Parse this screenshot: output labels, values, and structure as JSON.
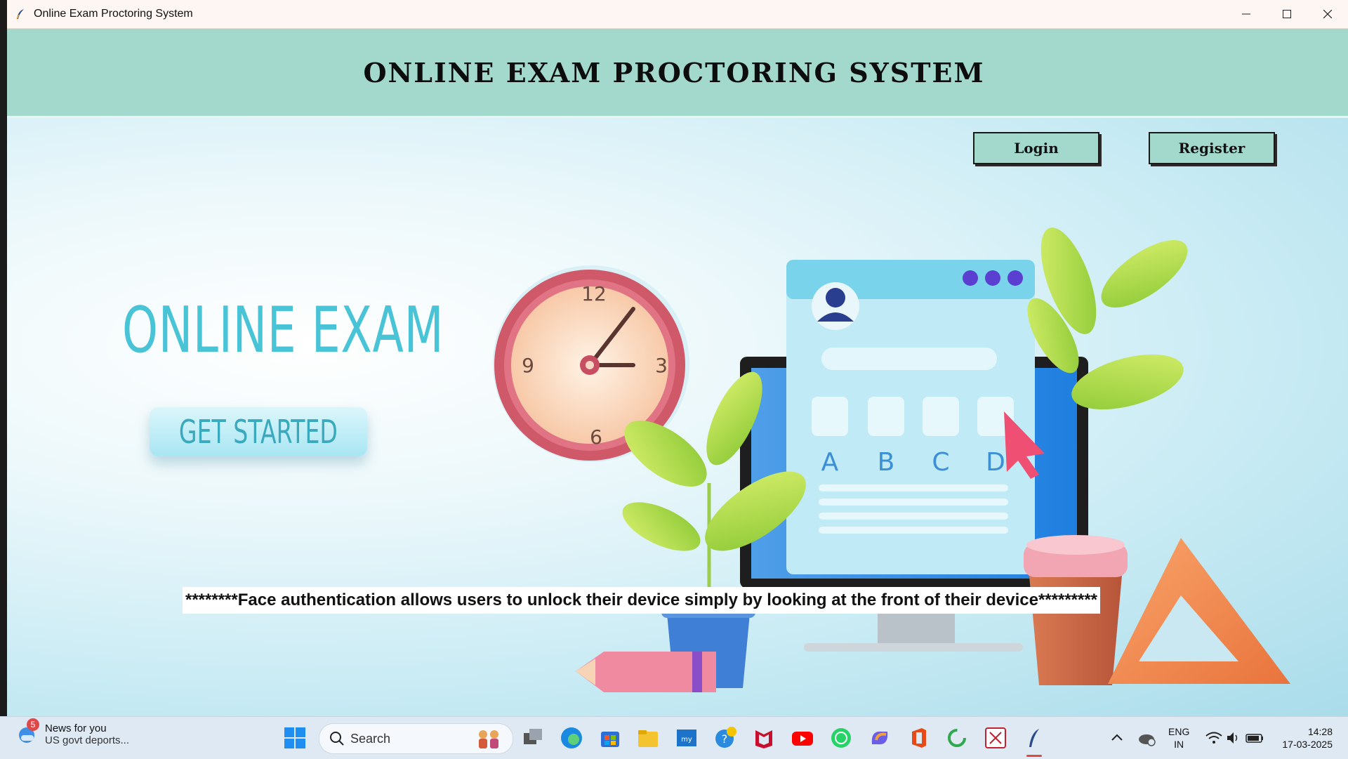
{
  "window": {
    "title": "Online Exam Proctoring System",
    "controls": [
      "minimize",
      "maximize",
      "close"
    ]
  },
  "header": {
    "title": "ONLINE EXAM PROCTORING SYSTEM"
  },
  "nav": {
    "login_label": "Login",
    "register_label": "Register"
  },
  "hero": {
    "title": "ONLINE EXAM",
    "cta_label": "GET STARTED",
    "clock_numbers": [
      "12",
      "3",
      "6",
      "9"
    ],
    "options": [
      "A",
      "B",
      "C",
      "D"
    ]
  },
  "marquee": {
    "text": "********Face authentication allows users to unlock their device simply by looking at the front of their device*********"
  },
  "colors": {
    "header_bg": "#a3d9cc",
    "button_bg": "#a3d9cc",
    "accent": "#49c4d6",
    "clock_rim": "#d85a6e"
  },
  "taskbar": {
    "news": {
      "badge": "5",
      "title": "News for you",
      "subtitle": "US govt deports..."
    },
    "search_placeholder": "Search",
    "pinned": [
      "task-view-icon",
      "edge-icon",
      "store-icon",
      "explorer-icon",
      "mylic-icon",
      "help-icon",
      "mcafee-icon",
      "youtube-icon",
      "whatsapp-icon",
      "copilot-icon",
      "office-icon",
      "refresh-app-icon",
      "snipping-icon",
      "python-feather-icon"
    ],
    "language": {
      "line1": "ENG",
      "line2": "IN"
    },
    "time": "14:28",
    "date": "17-03-2025"
  }
}
